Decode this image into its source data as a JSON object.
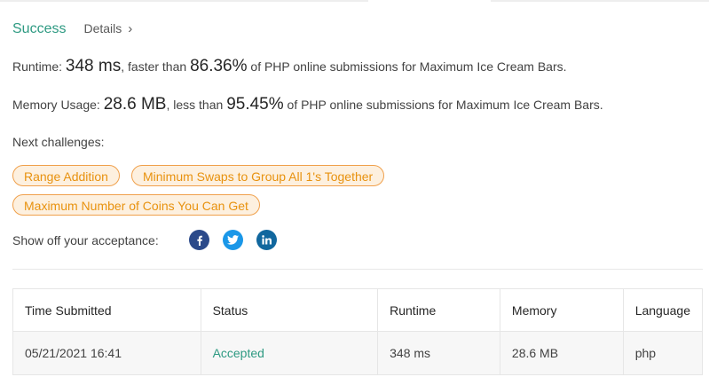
{
  "header": {
    "status": "Success",
    "details_label": "Details",
    "details_chevron": "›"
  },
  "runtime": {
    "label": "Runtime:",
    "value": "348 ms",
    "comparison": ", faster than",
    "percent": "86.36%",
    "suffix": "of PHP online submissions for Maximum Ice Cream Bars."
  },
  "memory": {
    "label": "Memory Usage:",
    "value": "28.6 MB",
    "comparison": ", less than",
    "percent": "95.45%",
    "suffix": "of PHP online submissions for Maximum Ice Cream Bars."
  },
  "next_challenges": {
    "label": "Next challenges:",
    "items": [
      "Range Addition",
      "Minimum Swaps to Group All 1's Together",
      "Maximum Number of Coins You Can Get"
    ]
  },
  "share": {
    "label": "Show off your acceptance:",
    "icons": [
      "facebook-icon",
      "twitter-icon",
      "linkedin-icon"
    ]
  },
  "table": {
    "headers": [
      "Time Submitted",
      "Status",
      "Runtime",
      "Memory",
      "Language"
    ],
    "rows": [
      [
        "05/21/2021 16:41",
        "Accepted",
        "348 ms",
        "28.6 MB",
        "php"
      ]
    ]
  },
  "colors": {
    "accent_green": "#2e9a82",
    "chip_orange": "#e8920f",
    "chip_bg": "#fdf0df",
    "facebook": "#2b4a8a",
    "twitter": "#1a97e8",
    "linkedin": "#11679e"
  }
}
